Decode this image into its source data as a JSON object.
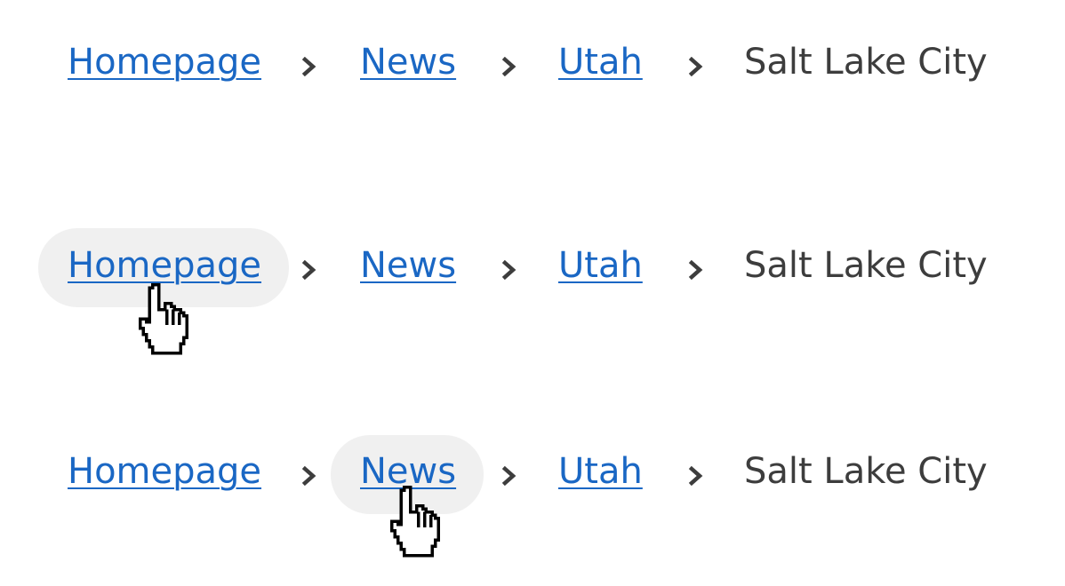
{
  "colors": {
    "link": "#1a67c4",
    "current": "#3d3d3d",
    "separator": "#3d3d3d",
    "hover_background": "#f0f0f0"
  },
  "breadcrumbs": [
    {
      "state": "default",
      "items": [
        {
          "label": "Homepage",
          "link": true
        },
        {
          "label": "News",
          "link": true
        },
        {
          "label": "Utah",
          "link": true
        },
        {
          "label": "Salt Lake City",
          "link": false
        }
      ],
      "separator_icon": "chevron-right-icon"
    },
    {
      "state": "hover-homepage",
      "hovered_item": "Homepage",
      "items": [
        {
          "label": "Homepage",
          "link": true
        },
        {
          "label": "News",
          "link": true
        },
        {
          "label": "Utah",
          "link": true
        },
        {
          "label": "Salt Lake City",
          "link": false
        }
      ],
      "separator_icon": "chevron-right-icon",
      "cursor_icon": "hand-pointer-icon"
    },
    {
      "state": "hover-news",
      "hovered_item": "News",
      "items": [
        {
          "label": "Homepage",
          "link": true
        },
        {
          "label": "News",
          "link": true
        },
        {
          "label": "Utah",
          "link": true
        },
        {
          "label": "Salt Lake City",
          "link": false
        }
      ],
      "separator_icon": "chevron-right-icon",
      "cursor_icon": "hand-pointer-icon"
    }
  ]
}
